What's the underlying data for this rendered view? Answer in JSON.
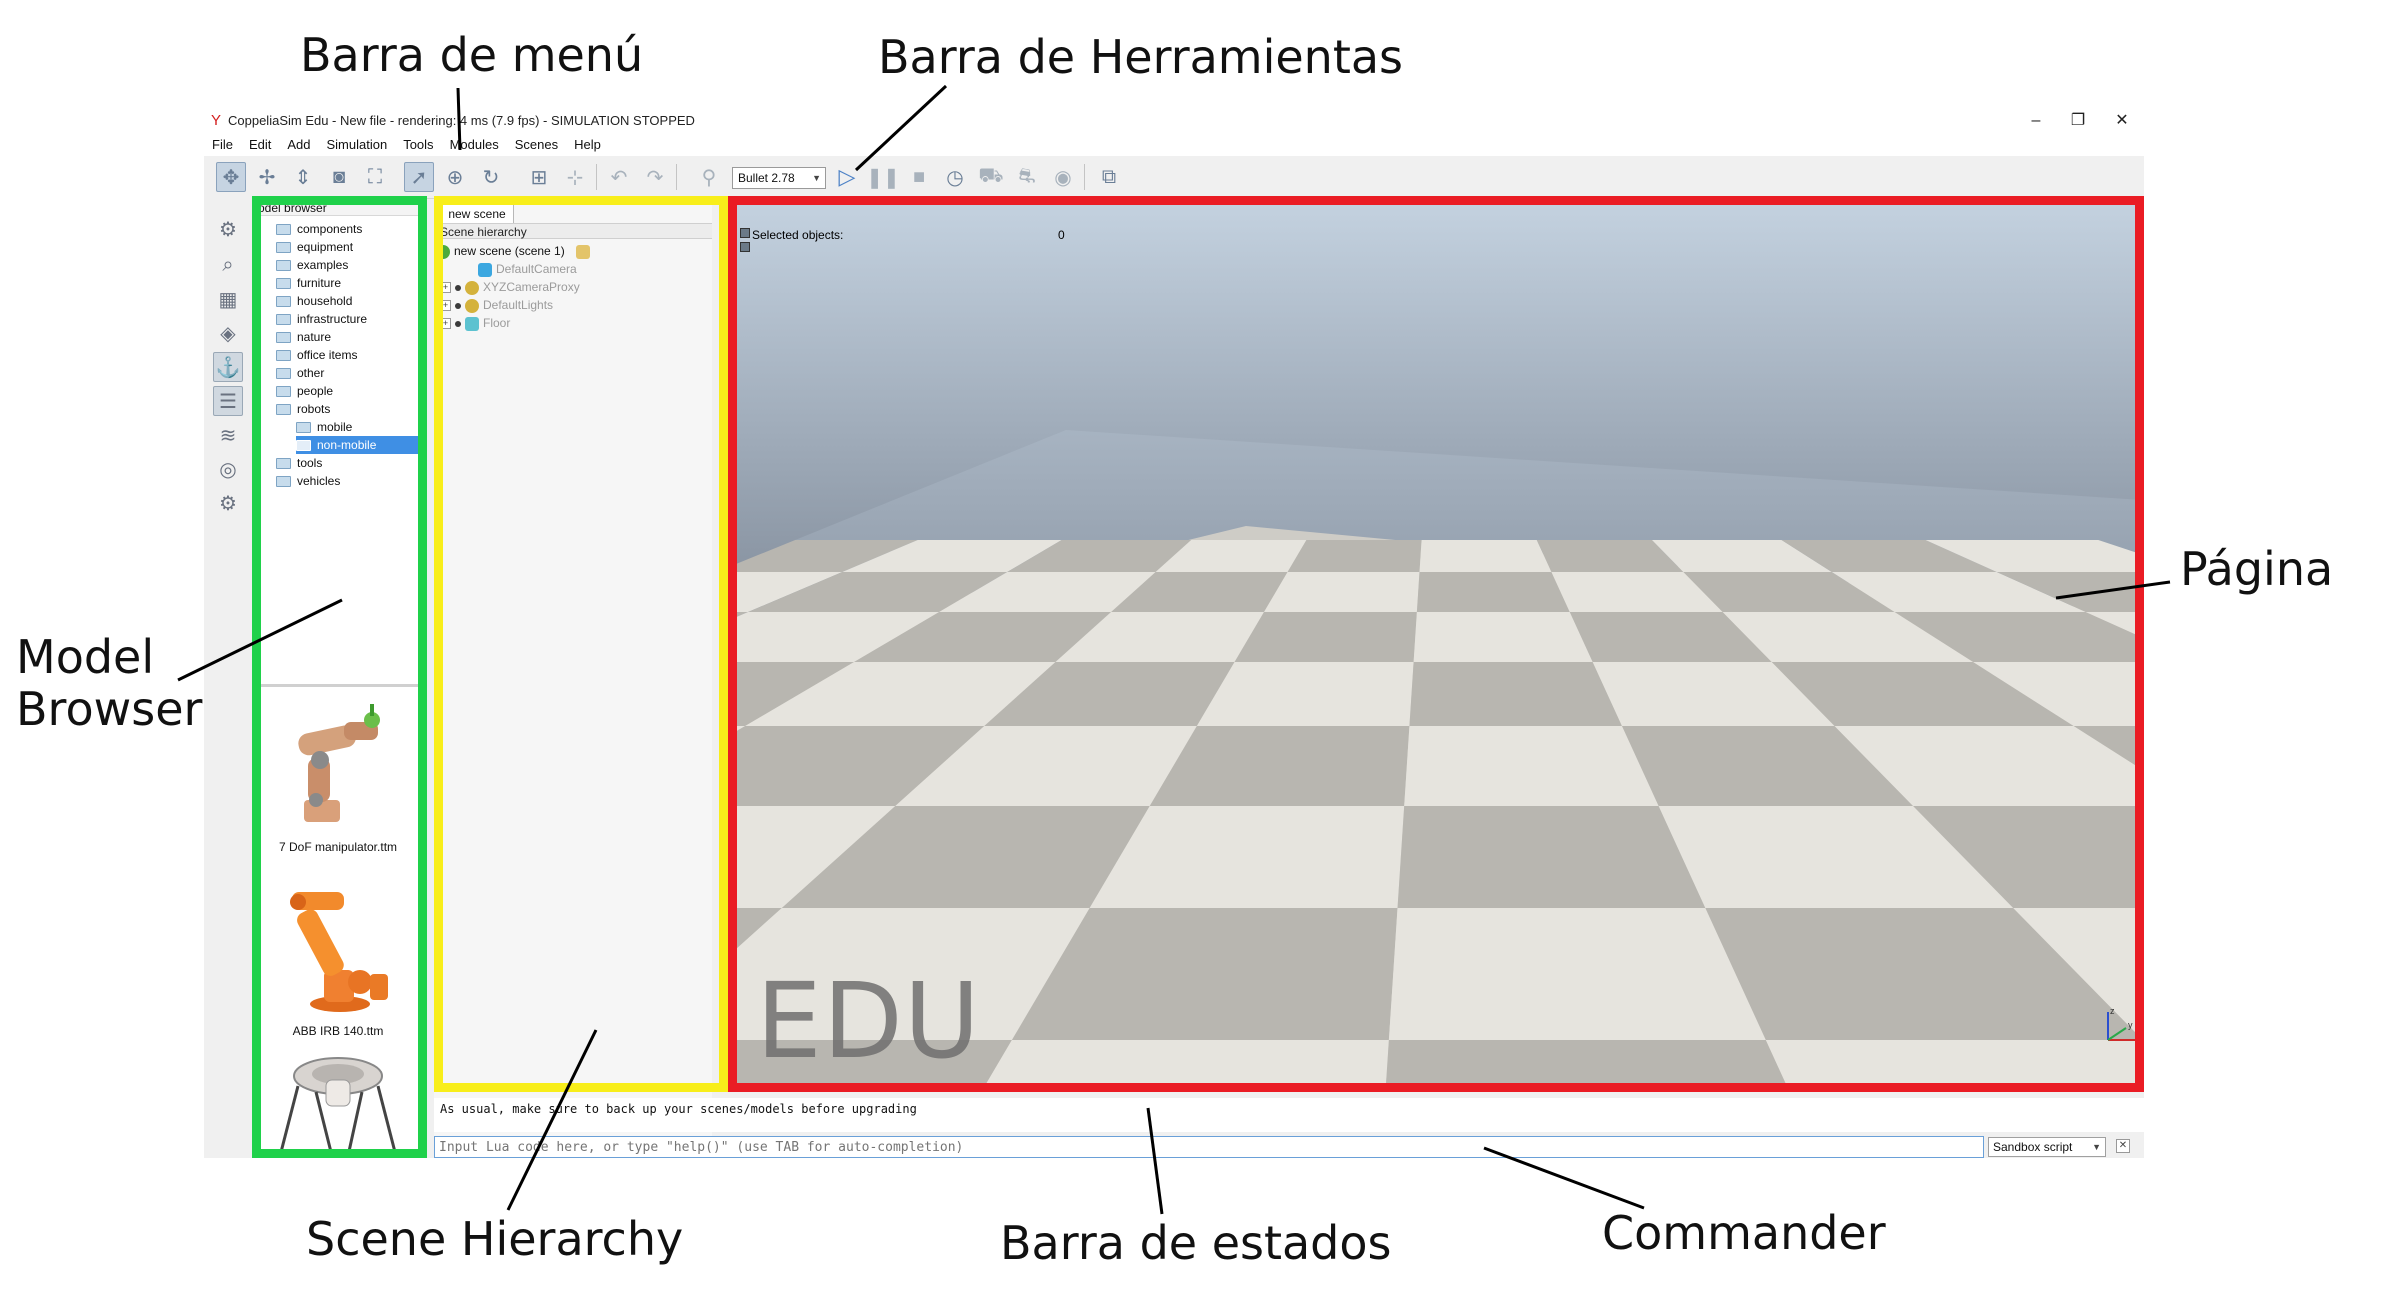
{
  "annotations": {
    "menu_bar": "Barra de menú",
    "toolbar": "Barra de Herramientas",
    "model_browser": "Model\nBrowser",
    "page": "Página",
    "scene_hierarchy": "Scene Hierarchy",
    "status_bar": "Barra de estados",
    "commander": "Commander"
  },
  "window": {
    "title": "CoppeliaSim Edu - New file - rendering: 4 ms (7.9 fps) - SIMULATION STOPPED",
    "minimize": "–",
    "maximize": "❐",
    "close": "✕"
  },
  "menu": [
    "File",
    "Edit",
    "Add",
    "Simulation",
    "Tools",
    "Modules",
    "Scenes",
    "Help"
  ],
  "toolbar": {
    "physics_engine": "Bullet 2.78",
    "icons": [
      "camera-pan-icon",
      "camera-rotate-icon",
      "camera-shift-icon",
      "camera-angle-icon",
      "fit-to-view-icon",
      "object-select-icon",
      "object-shift-icon",
      "object-rotate-icon",
      "assemble-icon",
      "transfer-dna-icon",
      "undo-icon",
      "redo-icon",
      "dynamics-toggle-icon",
      "start-simulation-icon",
      "pause-simulation-icon",
      "stop-simulation-icon",
      "realtime-icon",
      "slower-icon",
      "faster-icon",
      "visualization-icon",
      "page-selector-icon"
    ]
  },
  "model_browser": {
    "header": "odel browser",
    "folders": [
      "components",
      "equipment",
      "examples",
      "furniture",
      "household",
      "infrastructure",
      "nature",
      "office items",
      "other",
      "people",
      "robots",
      "mobile",
      "non-mobile",
      "tools",
      "vehicles"
    ],
    "selected": "non-mobile",
    "thumbnails": [
      "7 DoF manipulator.ttm",
      "ABB IRB 140.ttm"
    ]
  },
  "scene": {
    "tab": "new scene",
    "header": "Scene hierarchy",
    "root": "new scene (scene 1)",
    "objects": [
      "DefaultCamera",
      "XYZCameraProxy",
      "DefaultLights",
      "Floor"
    ]
  },
  "viewport": {
    "selected_label": "Selected objects:",
    "selected_count": "0",
    "watermark": "EDU",
    "axes": [
      "z",
      "y",
      "x"
    ]
  },
  "status": {
    "message": "As usual, make sure to back up your scenes/models before upgrading"
  },
  "commander": {
    "placeholder": "Input Lua code here, or type \"help()\" (use TAB for auto-completion)",
    "script": "Sandbox script"
  },
  "colors": {
    "model_browser_highlight": "#1fd14a",
    "scene_hierarchy_highlight": "#f8ee1a",
    "page_highlight": "#ea1c24",
    "selection": "#3f8fe4"
  }
}
